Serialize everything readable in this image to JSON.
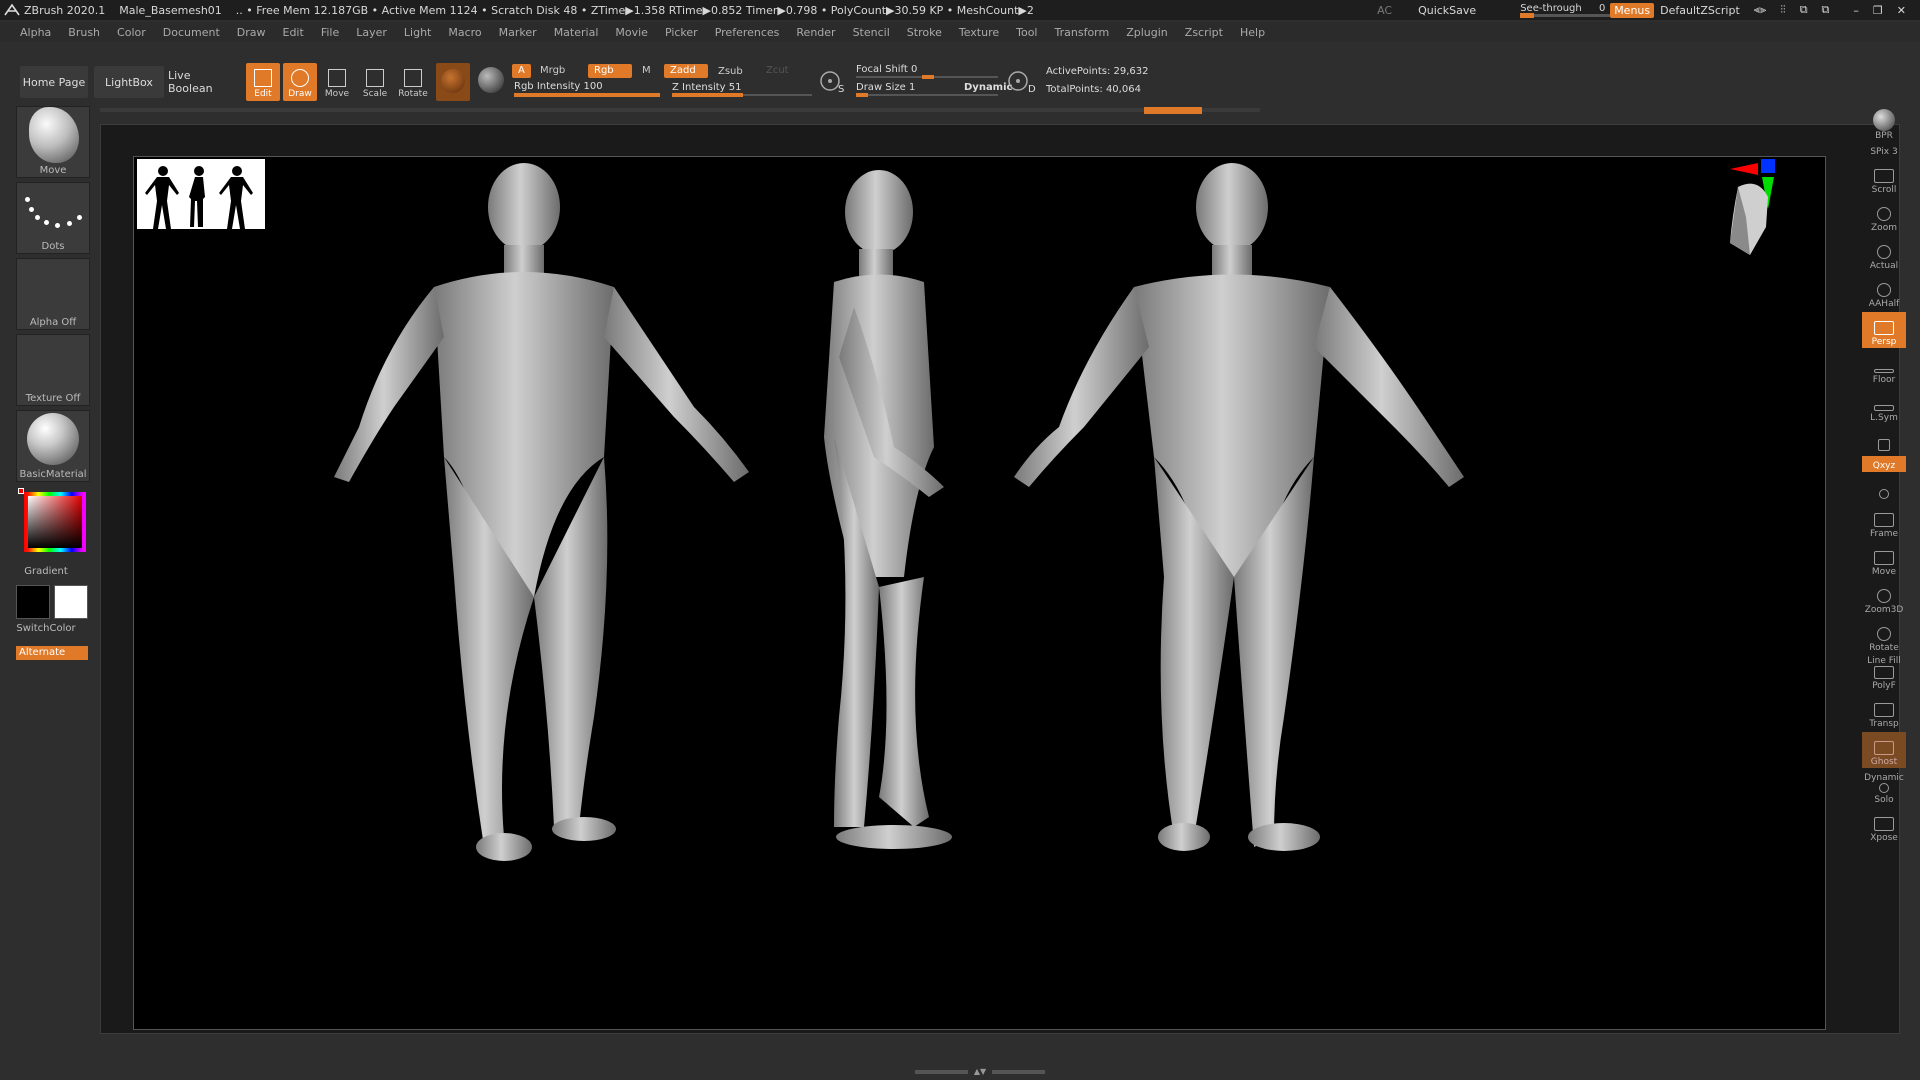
{
  "titlebar": {
    "app": "ZBrush 2020.1",
    "file": "Male_Basemesh01",
    "stats": ".. • Free Mem 12.187GB • Active Mem 1124 • Scratch Disk 48 •  ZTime▶1.358 RTime▶0.852 Timer▶0.798 • PolyCount▶30.59 KP  • MeshCount▶2",
    "ac": "AC",
    "quicksave": "QuickSave",
    "seethrough_label": "See-through",
    "seethrough_value": "0",
    "seethrough_level": 0,
    "menus": "Menus",
    "script": "DefaultZScript"
  },
  "menubar": [
    "Alpha",
    "Brush",
    "Color",
    "Document",
    "Draw",
    "Edit",
    "File",
    "Layer",
    "Light",
    "Macro",
    "Marker",
    "Material",
    "Movie",
    "Picker",
    "Preferences",
    "Render",
    "Stencil",
    "Stroke",
    "Texture",
    "Tool",
    "Transform",
    "Zplugin",
    "Zscript",
    "Help"
  ],
  "shelf": {
    "home": "Home Page",
    "lightbox": "LightBox",
    "liveboolean": "Live Boolean",
    "edit": "Edit",
    "draw": "Draw",
    "move": "Move",
    "scale": "Scale",
    "rotate": "Rotate",
    "a": "A",
    "mrgb": "Mrgb",
    "rgb": "Rgb",
    "m": "M",
    "zadd": "Zadd",
    "zsub": "Zsub",
    "zcut": "Zcut",
    "rgb_intensity_label": "Rgb Intensity",
    "rgb_intensity": "100",
    "rgb_intensity_level": 1.0,
    "z_intensity_label": "Z Intensity",
    "z_intensity": "51",
    "z_intensity_level": 0.51,
    "focal_label": "Focal Shift",
    "focal": "0",
    "focal_level": 0.5,
    "drawsize_label": "Draw Size",
    "drawsize": "1",
    "drawsize_level": 0.01,
    "dynamic": "Dynamic",
    "s": "S",
    "d": "D",
    "active_points": "ActivePoints: 29,632",
    "total_points": "TotalPoints: 40,064"
  },
  "leftpanel": {
    "brush": "Move",
    "stroke": "Dots",
    "alpha": "Alpha Off",
    "texture": "Texture Off",
    "material": "BasicMaterial",
    "gradient": "Gradient",
    "switchcolor": "SwitchColor",
    "alternate": "Alternate"
  },
  "rightpanel": {
    "bpr": "BPR",
    "spix": "SPix 3",
    "scroll": "Scroll",
    "zoom": "Zoom",
    "actual": "Actual",
    "aahalf": "AAHalf",
    "persp": "Persp",
    "floor": "Floor",
    "lsym": "L.Sym",
    "xyz": "Qxyz",
    "frame": "Frame",
    "move": "Move",
    "zoom3d": "Zoom3D",
    "rotate": "Rotate",
    "polyf": "PolyF",
    "transp": "Transp",
    "ghost": "Ghost",
    "solo": "Solo",
    "xpose": "Xpose",
    "line_fill": "Line Fill",
    "dynamic": "Dynamic"
  },
  "colors": {
    "accent": "#e07a28",
    "background": "#2e2e2e",
    "canvas": "#000000"
  }
}
